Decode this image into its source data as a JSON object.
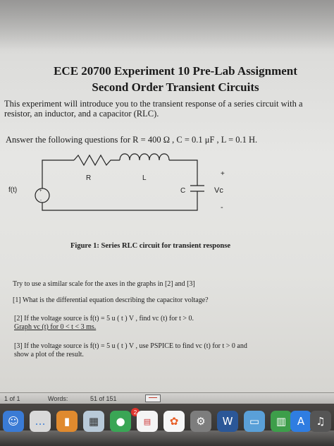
{
  "document": {
    "title_line1": "ECE 20700 Experiment 10 Pre-Lab Assignment",
    "title_line2": "Second Order Transient Circuits",
    "intro_line1": "This experiment will introduce you to the transient response of a series circuit with a",
    "intro_line2": "resistor, an inductor, and a capacitor (RLC).",
    "answer_line": "Answer the following questions for R = 400 Ω , C = 0.1 μF , L = 0.1 H.",
    "circuit": {
      "source_label": "f(t)",
      "resistor_label": "R",
      "inductor_label": "L",
      "capacitor_label": "C",
      "voltage_label": "Vc",
      "plus_sign": "+",
      "minus_sign": "-"
    },
    "figure_caption": "Figure 1: Series RLC circuit for transient response",
    "scale_note": "Try to use a similar scale for the axes in the graphs in [2] and [3]",
    "q1": "[1] What is the differential equation describing the capacitor voltage?",
    "q2_line1": "[2] If the voltage source is f(t) = 5 u ( t ) V ,  find  vc (t)  for t > 0.",
    "q2_line2": "Graph vc (t)  for  0 < t < 3 ms.",
    "q3_line1": "[3] If the voltage source is f(t) = 5 u ( t ) V ,  use PSPICE to find vc (t)  for t > 0 and",
    "q3_line2": "show a plot of the result."
  },
  "statusbar": {
    "page": "1 of 1",
    "words_label": "Words:",
    "word_count": "51 of 151"
  },
  "dock": {
    "badge_count": "2",
    "icons": [
      "finder-icon",
      "messages-icon",
      "books-icon",
      "preview-icon",
      "facetime-icon",
      "calendar-icon",
      "photos-icon",
      "system-preferences-icon",
      "word-icon",
      "folder-icon",
      "numbers-icon",
      "app-store-icon",
      "itunes-icon",
      "safari-icon"
    ]
  }
}
